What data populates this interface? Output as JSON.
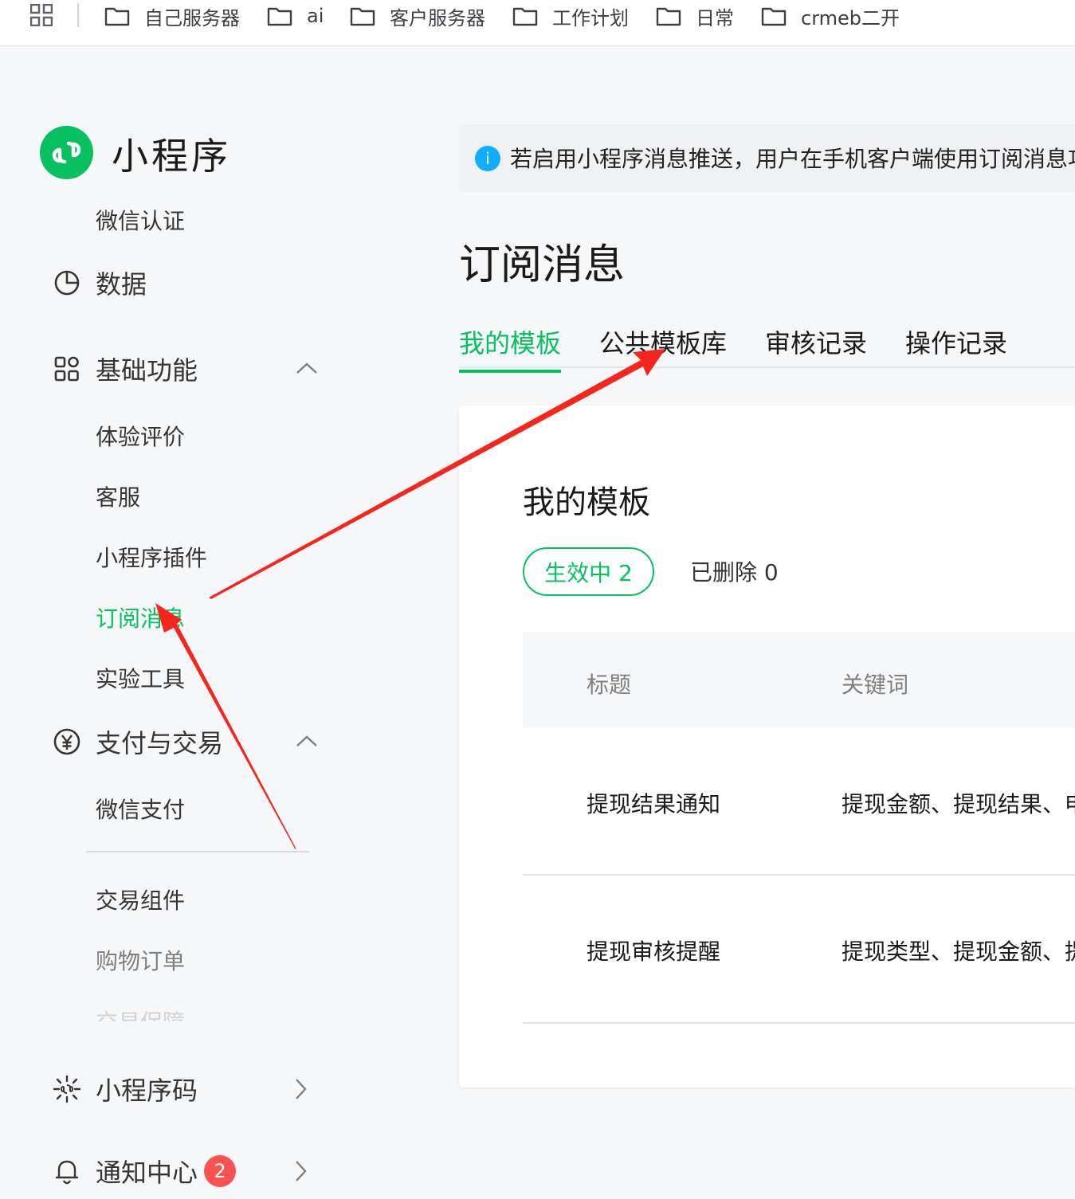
{
  "bookmarks": [
    {
      "label": "自己服务器"
    },
    {
      "label": "ai"
    },
    {
      "label": "客户服务器"
    },
    {
      "label": "工作计划"
    },
    {
      "label": "日常"
    },
    {
      "label": "crmeb二开"
    }
  ],
  "sidebar": {
    "brand": "小程序",
    "wechat_auth": "微信认证",
    "data": "数据",
    "basic": {
      "label": "基础功能",
      "items": [
        "体验评价",
        "客服",
        "小程序插件",
        "订阅消息",
        "实验工具"
      ]
    },
    "pay": {
      "label": "支付与交易",
      "items": [
        "微信支付",
        "交易组件",
        "购物订单",
        "交易保障"
      ]
    },
    "qrcode": "小程序码",
    "notify": {
      "label": "通知中心",
      "badge": "2"
    }
  },
  "notice": {
    "text": "若启用小程序消息推送，用户在手机客户端使用订阅消息功能"
  },
  "page_title": "订阅消息",
  "tabs": [
    "我的模板",
    "公共模板库",
    "审核记录",
    "操作记录"
  ],
  "card": {
    "title": "我的模板",
    "filter_active": "生效中  2",
    "filter_deleted": "已删除  0",
    "columns": [
      "标题",
      "关键词"
    ],
    "rows": [
      {
        "title": "提现结果通知",
        "keywords": "提现金额、提现结果、申请时间"
      },
      {
        "title": "提现审核提醒",
        "keywords": "提现类型、提现金额、提现时间"
      }
    ]
  },
  "colors": {
    "brand_green": "#07c160",
    "annotation_red": "#f5261e",
    "info_blue": "#10aeff",
    "badge_red": "#fa5151"
  }
}
